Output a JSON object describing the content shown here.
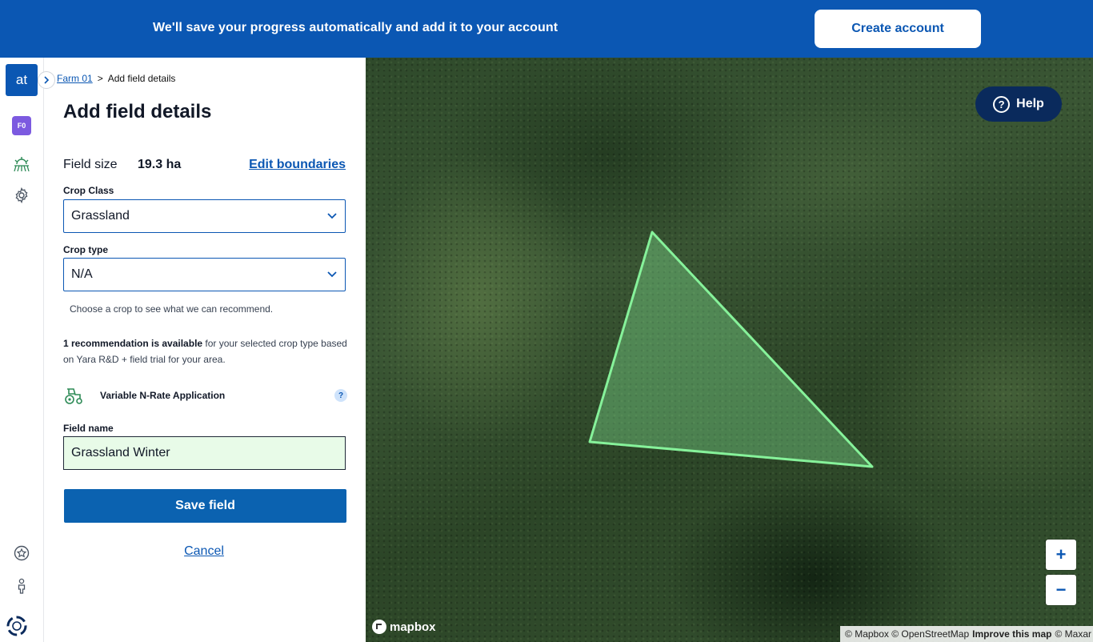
{
  "banner": {
    "message": "We'll save your progress automatically and add it to your account",
    "create_account": "Create account"
  },
  "rail": {
    "logo_text": "at",
    "farm_badge": "F0"
  },
  "breadcrumb": {
    "farm": "Farm 01",
    "separator": ">",
    "current": "Add field details"
  },
  "form": {
    "title": "Add field details",
    "field_size_label": "Field size",
    "field_size_value": "19.3 ha",
    "edit_boundaries": "Edit boundaries",
    "crop_class_label": "Crop Class",
    "crop_class_value": "Grassland",
    "crop_type_label": "Crop type",
    "crop_type_value": "N/A",
    "hint": "Choose a crop to see what we can recommend.",
    "rec_bold": "1 recommendation is available",
    "rec_rest": " for your selected crop type based on Yara R&D + field trial for your area.",
    "vnr_label": "Variable N-Rate Application",
    "help_mark": "?",
    "field_name_label": "Field name",
    "field_name_value": "Grassland Winter",
    "save": "Save field",
    "cancel": "Cancel"
  },
  "map": {
    "help": "Help",
    "help_mark": "?",
    "zoom_in": "+",
    "zoom_out": "−",
    "brand": "mapbox",
    "attrib_1": "© Mapbox © OpenStreetMap",
    "attrib_2": "Improve this map",
    "attrib_3": "© Maxar",
    "polygon_color": "#86f29a"
  },
  "colors": {
    "brand_blue": "#0b57b3",
    "field_green": "#e8fbe8"
  }
}
